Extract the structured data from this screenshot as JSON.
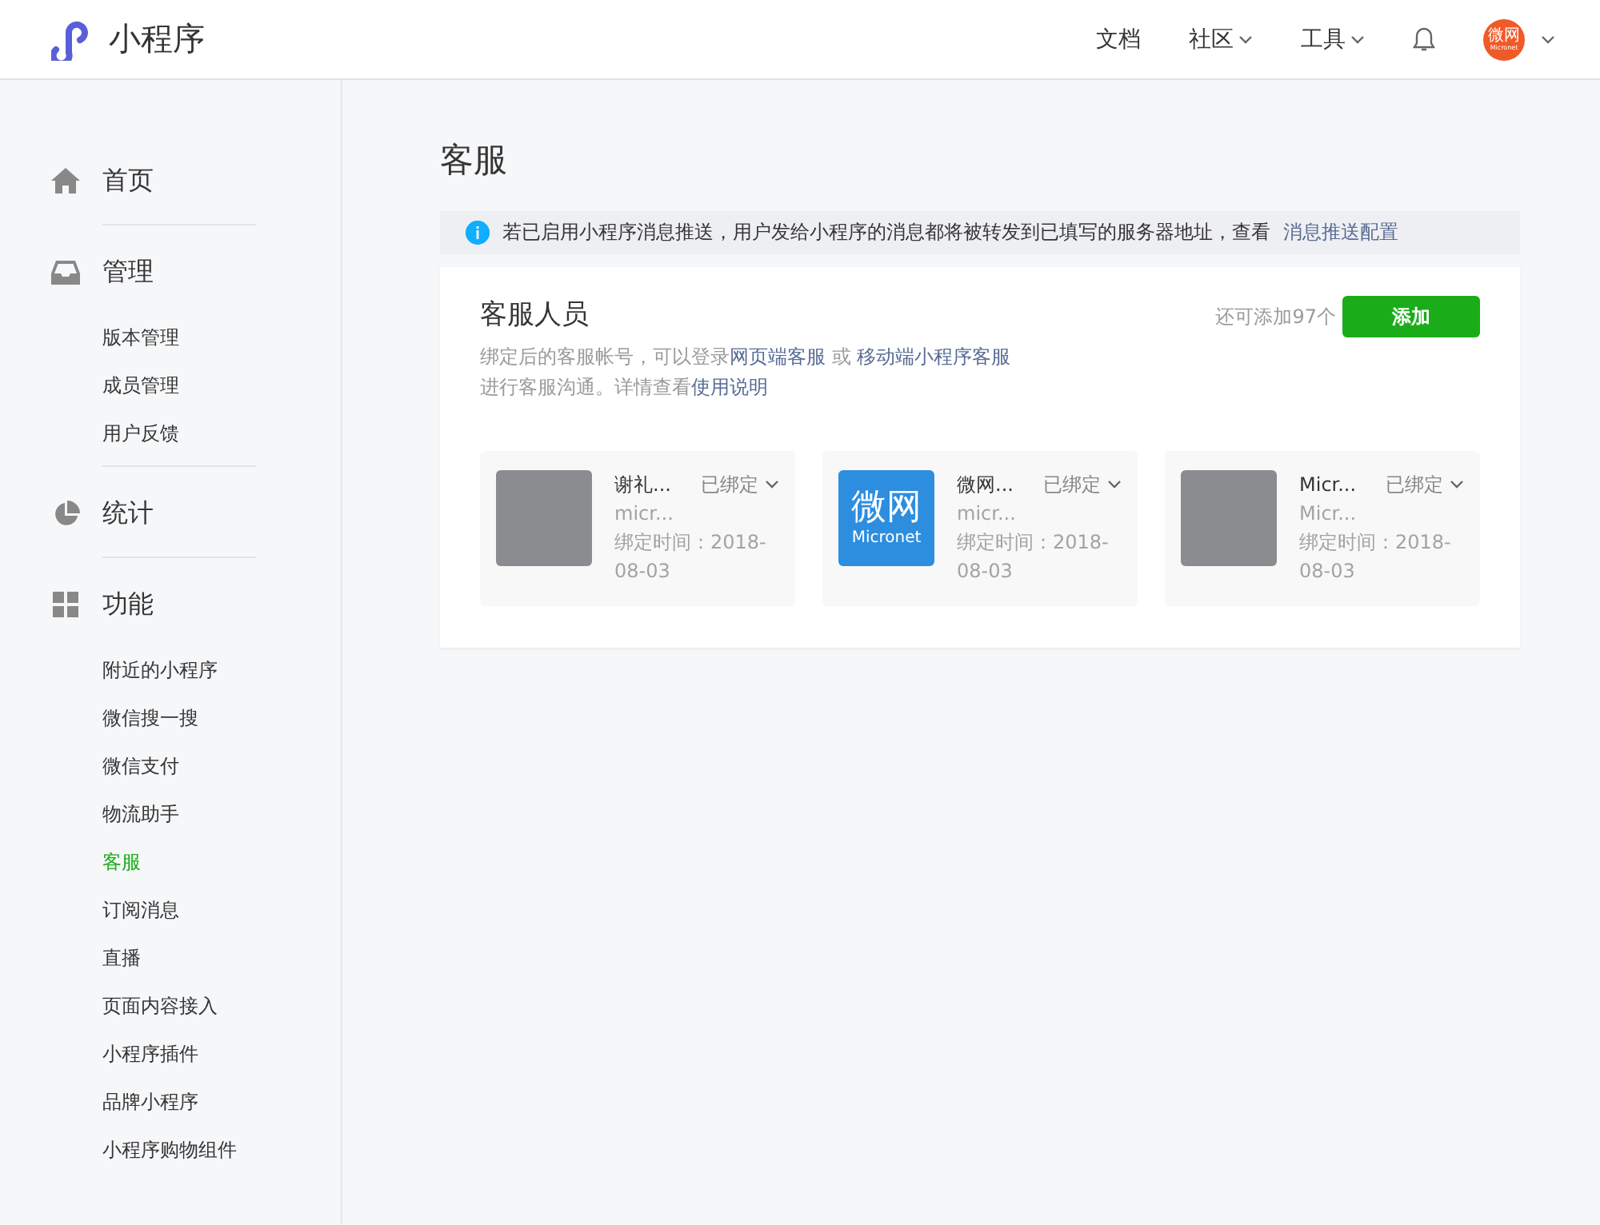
{
  "header": {
    "logo_text": "小程序",
    "nav": [
      {
        "label": "文档",
        "has_caret": false
      },
      {
        "label": "社区",
        "has_caret": true
      },
      {
        "label": "工具",
        "has_caret": true
      }
    ],
    "avatar": {
      "title": "微网",
      "subtitle": "Micronet"
    }
  },
  "sidebar": {
    "sections": [
      {
        "kind": "home",
        "label": "首页"
      },
      {
        "kind": "inbox",
        "label": "管理",
        "items": [
          {
            "label": "版本管理",
            "selected": false
          },
          {
            "label": "成员管理",
            "selected": false
          },
          {
            "label": "用户反馈",
            "selected": false
          }
        ]
      },
      {
        "kind": "pie",
        "label": "统计"
      },
      {
        "kind": "grid",
        "label": "功能",
        "items": [
          {
            "label": "附近的小程序",
            "selected": false
          },
          {
            "label": "微信搜一搜",
            "selected": false
          },
          {
            "label": "微信支付",
            "selected": false
          },
          {
            "label": "物流助手",
            "selected": false
          },
          {
            "label": "客服",
            "selected": true
          },
          {
            "label": "订阅消息",
            "selected": false
          },
          {
            "label": "直播",
            "selected": false
          },
          {
            "label": "页面内容接入",
            "selected": false
          },
          {
            "label": "小程序插件",
            "selected": false
          },
          {
            "label": "品牌小程序",
            "selected": false
          },
          {
            "label": "小程序购物组件",
            "selected": false
          }
        ]
      }
    ]
  },
  "page_title": "客服",
  "notice": {
    "text": "若已启用小程序消息推送，用户发给小程序的消息都将被转发到已填写的服务器地址，查看",
    "link": "消息推送配置"
  },
  "panel": {
    "title": "客服人员",
    "desc_1": "绑定后的客服帐号，可以登录",
    "link_1": "网页端客服",
    "desc_2": "或",
    "link_2": "移动端小程序客服",
    "desc_3": "进行客服沟通。详情查看",
    "link_3": "使用说明",
    "remaining": "还可添加97个",
    "add_button": "添加",
    "staff": [
      {
        "avatar": {
          "kind": "photo"
        },
        "name": "谢礼...",
        "status": "已绑定",
        "account": "micr...",
        "bind_time": "绑定时间：2018-08-03"
      },
      {
        "avatar": {
          "kind": "logo",
          "title": "微网",
          "subtitle": "Micronet"
        },
        "name": "微网...",
        "status": "已绑定",
        "account": "micr...",
        "bind_time": "绑定时间：2018-08-03"
      },
      {
        "avatar": {
          "kind": "photo"
        },
        "name": "Micr...",
        "status": "已绑定",
        "account": "Micr...",
        "bind_time": "绑定时间：2018-08-03"
      }
    ]
  }
}
